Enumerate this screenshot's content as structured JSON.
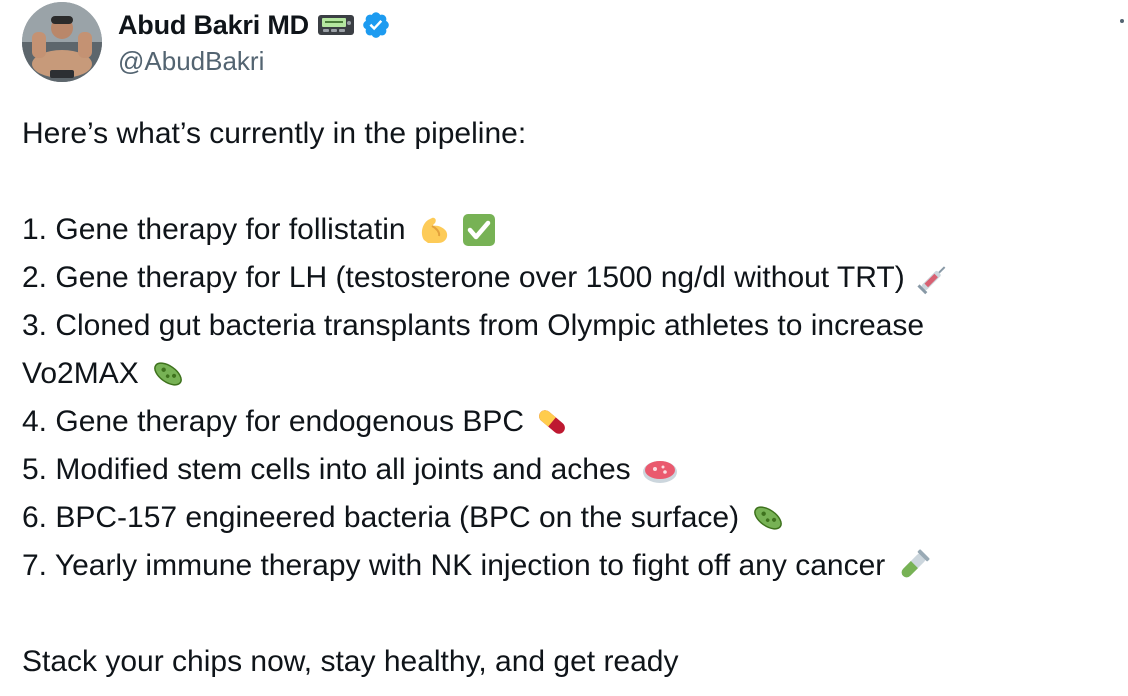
{
  "author": {
    "name": "Abud Bakri MD",
    "handle": "@AbudBakri"
  },
  "icons": {
    "avatar": "profile-photo",
    "badge": "pager-icon",
    "verified": "verified-badge-icon",
    "more": "more-options-icon"
  },
  "colors": {
    "text": "#0f1419",
    "secondary": "#536471",
    "verified": "#1d9bf0"
  },
  "tweet": {
    "intro": "Here’s what’s currently in the pipeline:",
    "items": [
      "1. Gene therapy for follistatin",
      "2. Gene therapy for LH (testosterone over 1500 ng/dl without TRT)",
      "3. Cloned gut bacteria transplants from Olympic athletes to increase",
      "Vo2MAX",
      "4. Gene therapy for endogenous BPC",
      "5. Modified stem cells into all joints and aches",
      "6. BPC-157 engineered bacteria (BPC on the surface)",
      "7. Yearly immune therapy with NK injection to fight off any cancer"
    ],
    "emoji_names": [
      "flexed-biceps-emoji",
      "check-mark-emoji",
      "syringe-emoji",
      "microbe-emoji",
      "pill-emoji",
      "petri-dish-emoji",
      "microbe-emoji",
      "test-tube-emoji"
    ],
    "outro": "Stack your chips now, stay healthy, and get ready"
  }
}
